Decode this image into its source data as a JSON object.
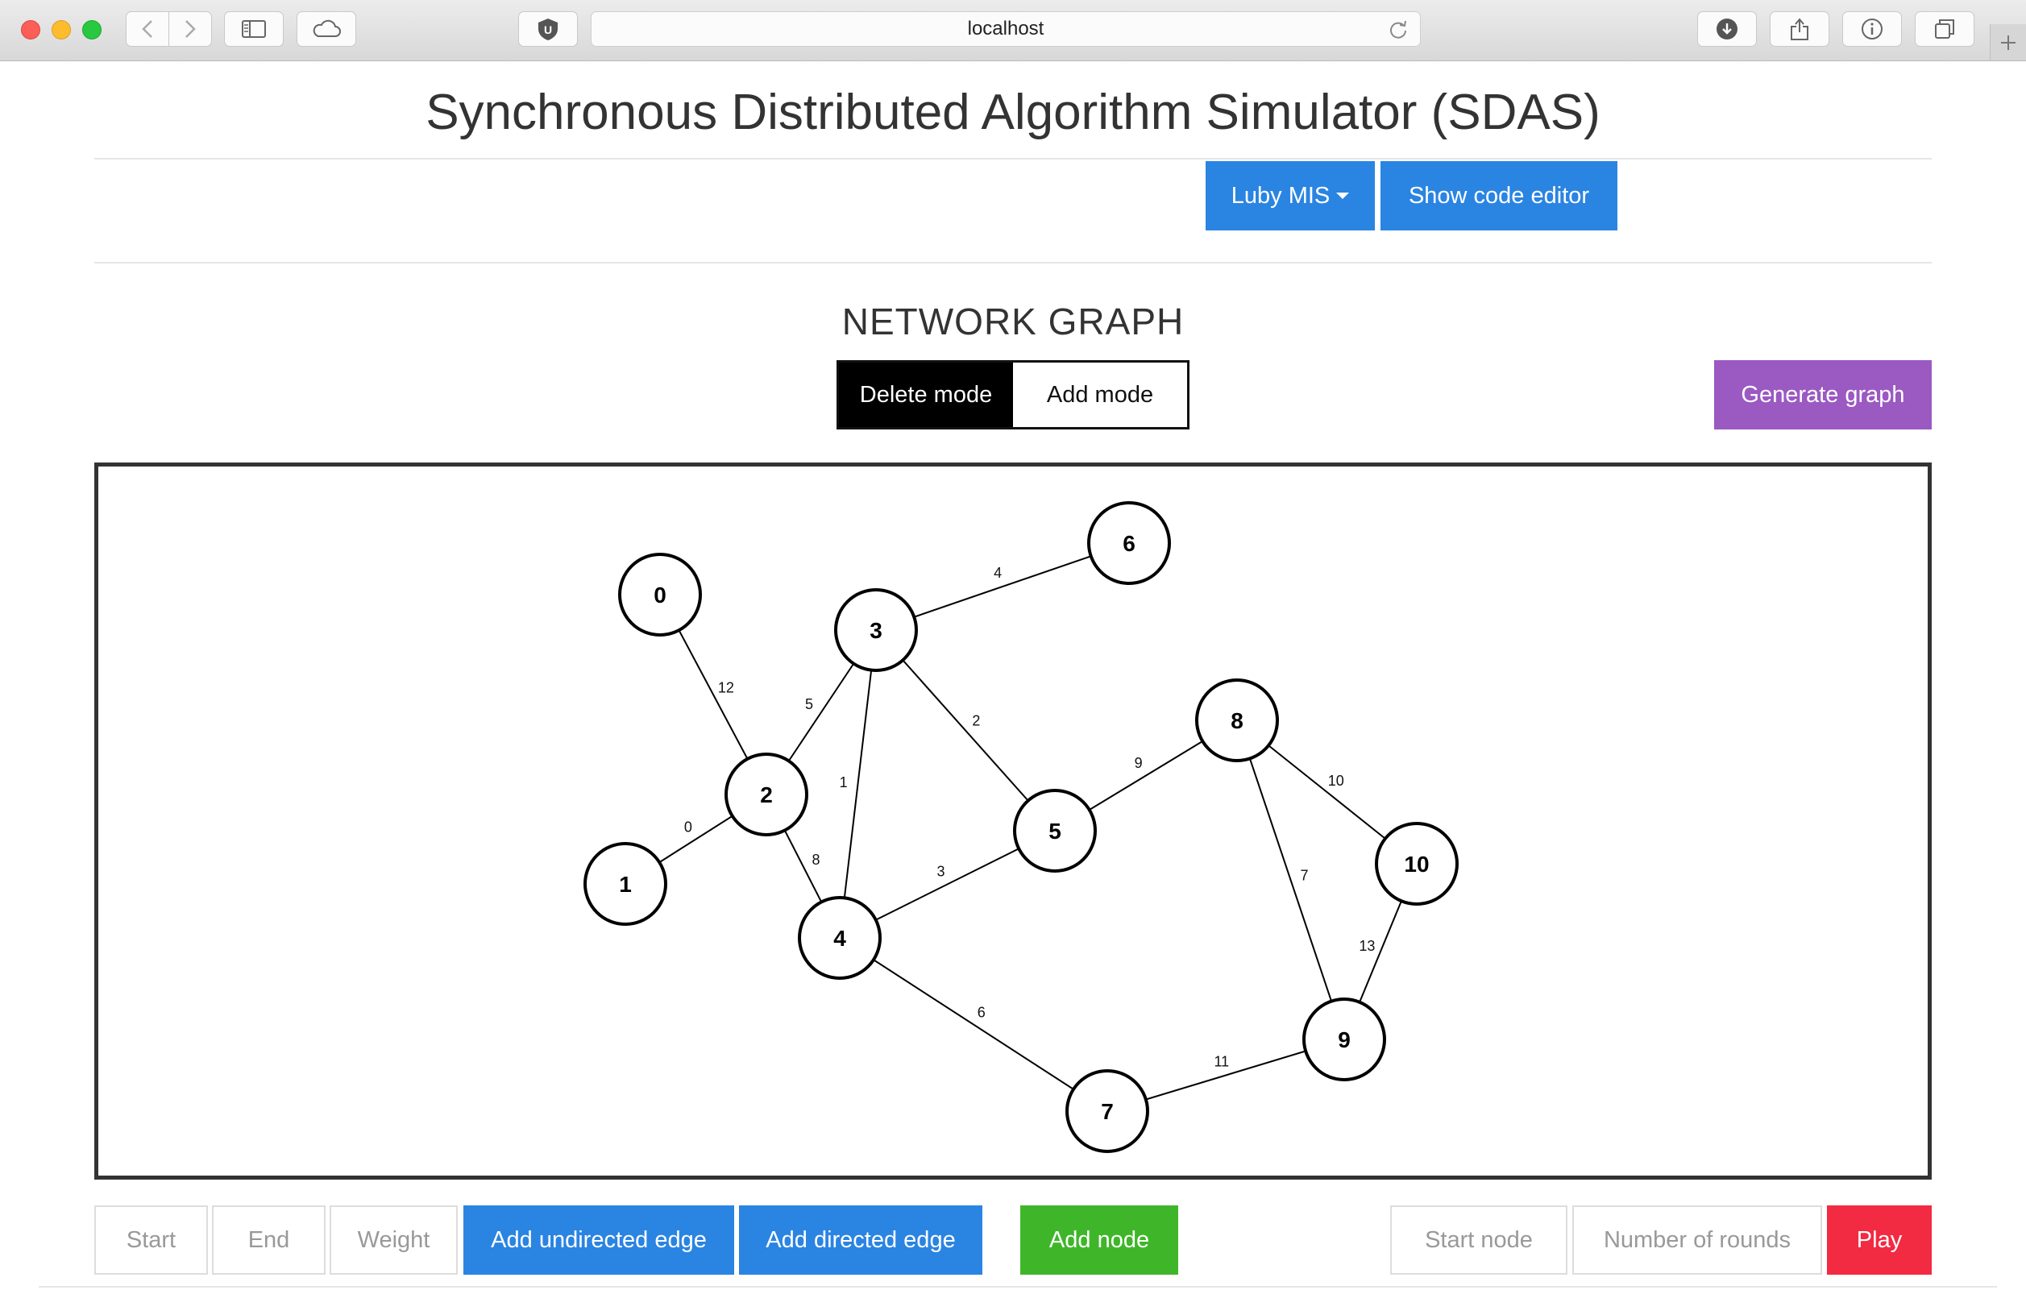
{
  "browser": {
    "url": "localhost",
    "icons": {
      "back": "chevron-left-icon",
      "forward": "chevron-right-icon",
      "sidebar": "sidebar-icon",
      "icloud": "cloud-icon",
      "extension": "ublock-icon",
      "reload": "reload-icon",
      "download": "download-icon",
      "share": "share-icon",
      "info": "info-icon",
      "tabs": "tabs-icon",
      "new_tab": "plus-icon"
    }
  },
  "header": {
    "title": "Synchronous Distributed Algorithm Simulator (SDAS)",
    "algorithm_dropdown": "Luby MIS",
    "code_editor_button": "Show code editor"
  },
  "graph_section": {
    "title": "NETWORK GRAPH",
    "modes": [
      "Delete mode",
      "Add mode"
    ],
    "active_mode": "Delete mode",
    "generate_button": "Generate graph"
  },
  "graph": {
    "nodes": [
      {
        "id": "0"
      },
      {
        "id": "1"
      },
      {
        "id": "2"
      },
      {
        "id": "3"
      },
      {
        "id": "4"
      },
      {
        "id": "5"
      },
      {
        "id": "6"
      },
      {
        "id": "7"
      },
      {
        "id": "8"
      },
      {
        "id": "9"
      },
      {
        "id": "10"
      }
    ],
    "edges": [
      {
        "source": "0",
        "target": "2",
        "weight": "12"
      },
      {
        "source": "1",
        "target": "2",
        "weight": "0"
      },
      {
        "source": "2",
        "target": "3",
        "weight": "5"
      },
      {
        "source": "2",
        "target": "4",
        "weight": "8"
      },
      {
        "source": "3",
        "target": "4",
        "weight": "1"
      },
      {
        "source": "3",
        "target": "6",
        "weight": "4"
      },
      {
        "source": "3",
        "target": "5",
        "weight": "2"
      },
      {
        "source": "4",
        "target": "5",
        "weight": "3"
      },
      {
        "source": "4",
        "target": "7",
        "weight": "6"
      },
      {
        "source": "5",
        "target": "8",
        "weight": "9"
      },
      {
        "source": "8",
        "target": "10",
        "weight": "10"
      },
      {
        "source": "8",
        "target": "9",
        "weight": "7"
      },
      {
        "source": "10",
        "target": "9",
        "weight": "13"
      },
      {
        "source": "7",
        "target": "9",
        "weight": "11"
      }
    ]
  },
  "controls": {
    "start_placeholder": "Start",
    "end_placeholder": "End",
    "weight_placeholder": "Weight",
    "add_undirected_edge": "Add undirected edge",
    "add_directed_edge": "Add directed edge",
    "add_node": "Add node",
    "start_node_placeholder": "Start node",
    "rounds_placeholder": "Number of rounds",
    "play": "Play"
  },
  "colors": {
    "blue": "#2a84e2",
    "purple": "#9b59c2",
    "green": "#3fb62a",
    "red": "#f22a42"
  }
}
